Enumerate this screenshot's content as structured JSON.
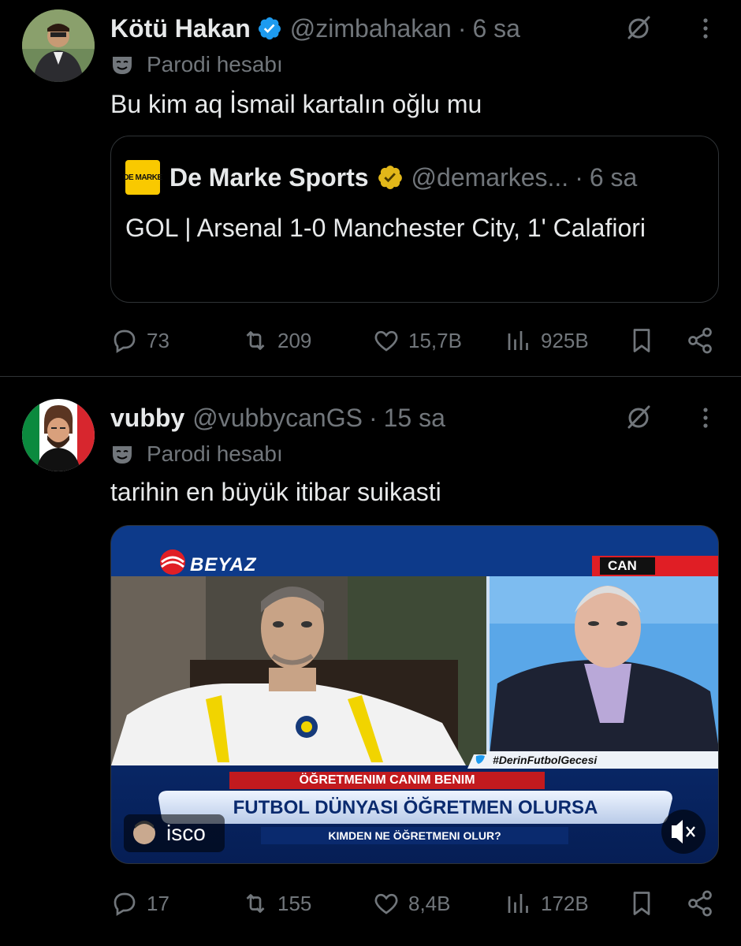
{
  "tweets": [
    {
      "display_name": "Kötü Hakan",
      "handle": "@zimbahakan",
      "time": "6 sa",
      "parody_label": "Parodi hesabı",
      "text": "Bu kim aq İsmail kartalın oğlu mu",
      "quote": {
        "logo_text": "DE MARKE",
        "display_name": "De Marke Sports",
        "handle": "@demarkes...",
        "time": "6 sa",
        "text": "GOL | Arsenal 1-0 Manchester City, 1' Calafiori"
      },
      "stats": {
        "replies": "73",
        "reposts": "209",
        "likes": "15,7B",
        "views": "925B"
      }
    },
    {
      "display_name": "vubby",
      "handle": "@vubbycanGS",
      "time": "15 sa",
      "parody_label": "Parodi hesabı",
      "text": "tarihin en büyük itibar suikasti",
      "media": {
        "channel_logo": "BEYAZ",
        "live_tag": "CAN",
        "hashtag": "#DerinFutbolGecesi",
        "banner_top": "ÖĞRETMENIM CANIM BENIM",
        "banner_main": "FUTBOL DÜNYASI ÖĞRETMEN OLURSA",
        "banner_sub": "KIMDEN NE ÖĞRETMENI OLUR?",
        "uploader": "isco"
      },
      "stats": {
        "replies": "17",
        "reposts": "155",
        "likes": "8,4B",
        "views": "172B"
      }
    }
  ],
  "colors": {
    "background": "#000000",
    "text": "#e7e9ea",
    "muted": "#71767b",
    "verified_blue": "#1d9bf0",
    "verified_gold": "#e2b719",
    "border": "#2f3336"
  }
}
